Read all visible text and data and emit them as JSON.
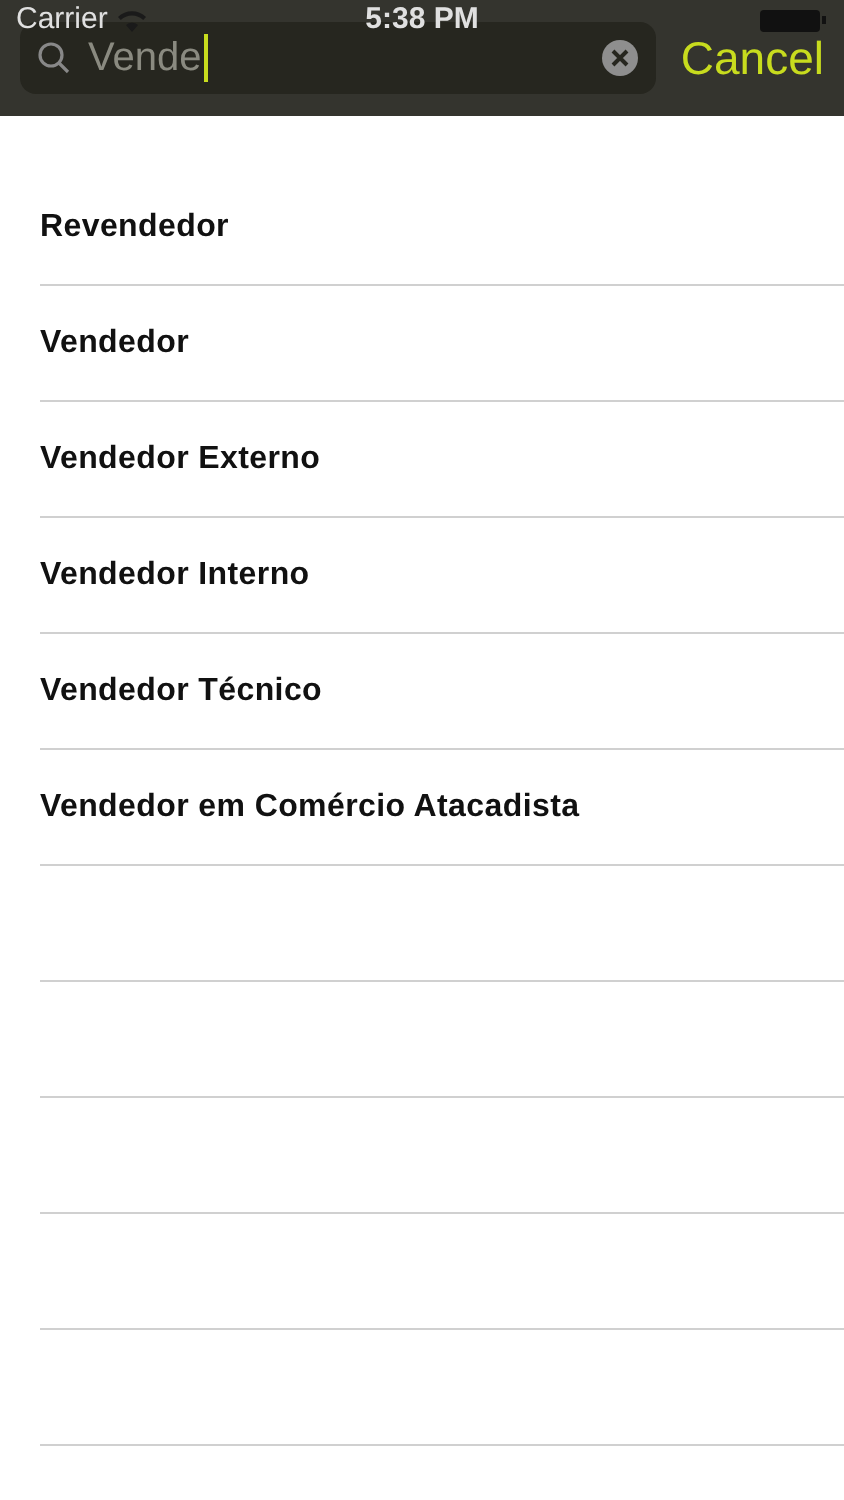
{
  "status_bar": {
    "carrier": "Carrier",
    "time": "5:38 PM"
  },
  "search": {
    "value": "Vende",
    "cancel": "Cancel"
  },
  "results": [
    "Revendedor",
    "Vendedor",
    "Vendedor Externo",
    "Vendedor Interno",
    "Vendedor Técnico",
    "Vendedor em Comércio Atacadista"
  ]
}
